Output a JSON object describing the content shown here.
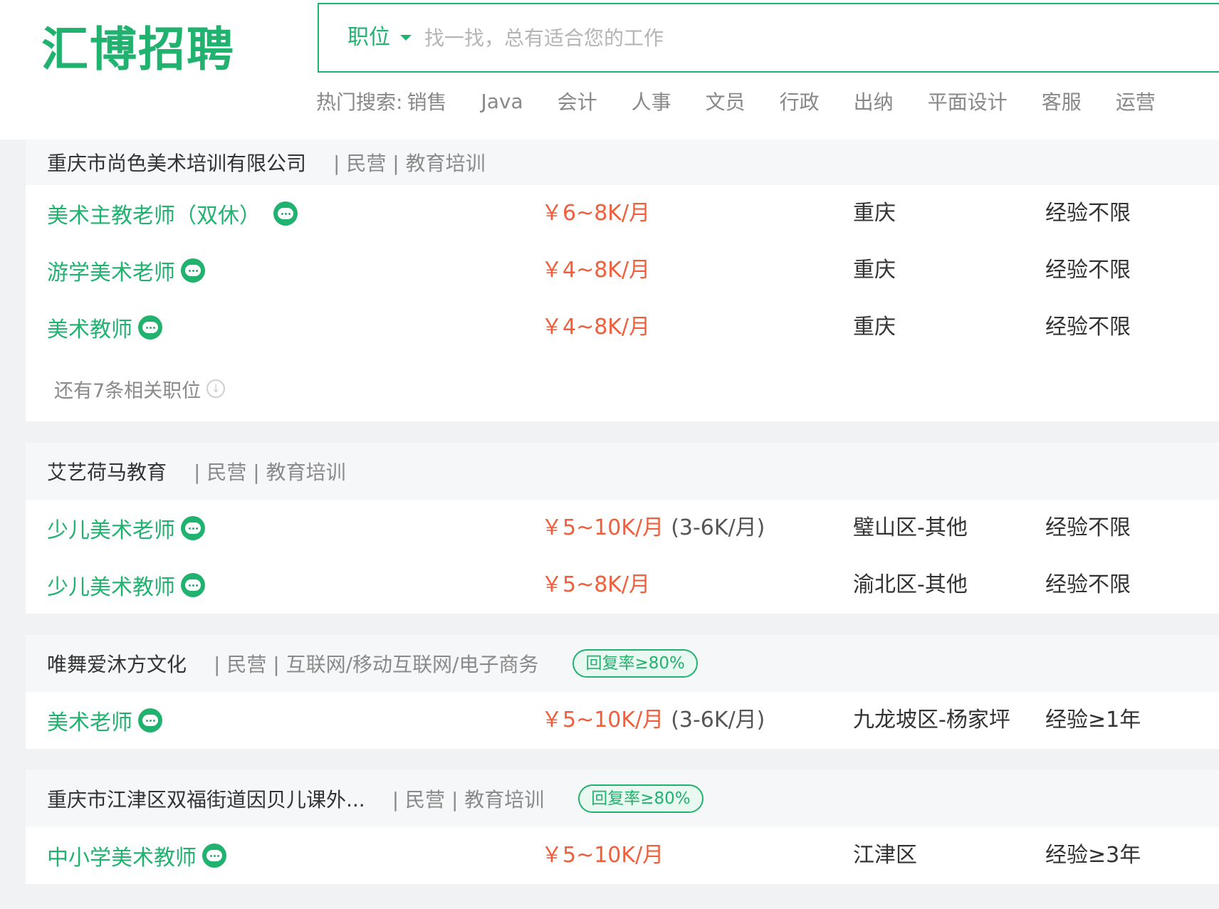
{
  "header": {
    "logo_text": "汇博招聘",
    "search": {
      "type_label": "职位",
      "placeholder": "找一找，总有适合您的工作"
    },
    "hot_search": {
      "label": "热门搜索:",
      "items": [
        "销售",
        "Java",
        "会计",
        "人事",
        "文员",
        "行政",
        "出纳",
        "平面设计",
        "客服",
        "运营"
      ]
    }
  },
  "companies": [
    {
      "name": "重庆市尚色美术培训有限公司",
      "meta": "| 民营 | 教育培训",
      "jobs": [
        {
          "title": "美术主教老师（双休）",
          "salary": "￥6~8K/月",
          "salary_extra": "",
          "location": "重庆",
          "experience": "经验不限"
        },
        {
          "title": "游学美术老师",
          "salary": "￥4~8K/月",
          "salary_extra": "",
          "location": "重庆",
          "experience": "经验不限"
        },
        {
          "title": "美术教师",
          "salary": "￥4~8K/月",
          "salary_extra": "",
          "location": "重庆",
          "experience": "经验不限"
        }
      ],
      "more_label": "还有7条相关职位"
    },
    {
      "name": "艾艺荷马教育",
      "meta": "| 民营 | 教育培训",
      "jobs": [
        {
          "title": "少儿美术老师",
          "salary": "￥5~10K/月",
          "salary_extra": "(3-6K/月)",
          "location": "璧山区-其他",
          "experience": "经验不限"
        },
        {
          "title": "少儿美术教师",
          "salary": "￥5~8K/月",
          "salary_extra": "",
          "location": "渝北区-其他",
          "experience": "经验不限"
        }
      ]
    },
    {
      "name": "唯舞爱沐方文化",
      "meta": "| 民营 | 互联网/移动互联网/电子商务",
      "badge": "回复率≥80%",
      "jobs": [
        {
          "title": "美术老师",
          "salary": "￥5~10K/月",
          "salary_extra": "(3-6K/月)",
          "location": "九龙坡区-杨家坪",
          "experience": "经验≥1年"
        }
      ]
    },
    {
      "name": "重庆市江津区双福街道因贝儿课外...",
      "meta": "| 民营 | 教育培训",
      "badge": "回复率≥80%",
      "jobs": [
        {
          "title": "中小学美术教师",
          "salary": "￥5~10K/月",
          "salary_extra": "",
          "location": "江津区",
          "experience": "经验≥3年"
        }
      ]
    }
  ],
  "colors": {
    "brand_green": "#22b26f",
    "salary_red": "#f25d3a",
    "page_bg": "#f1f2f3"
  },
  "icons": {
    "chat": "chat-bubble-icon",
    "more": "circle-arrow-down-icon"
  }
}
